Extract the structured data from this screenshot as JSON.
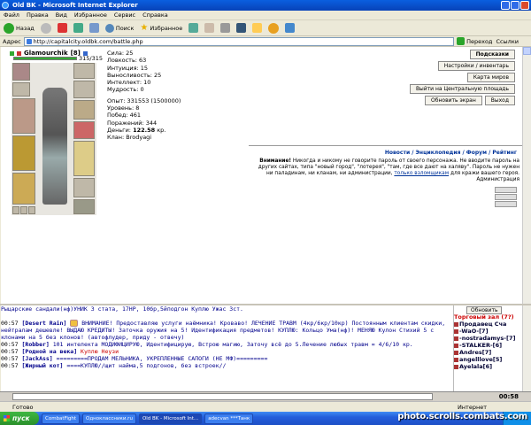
{
  "window": {
    "title": "Old BK - Microsoft Internet Explorer"
  },
  "menu": [
    "Файл",
    "Правка",
    "Вид",
    "Избранное",
    "Сервис",
    "Справка"
  ],
  "toolbar": {
    "back": "Назад",
    "search": "Поиск",
    "favorites": "Избранное"
  },
  "address": {
    "label": "Адрес",
    "url": "http://capitalcity.oldbk.com/battle.php",
    "go": "Переход",
    "links": "Ссылки"
  },
  "character": {
    "name": "Glamourchik",
    "level": "[8]",
    "hp": "315/315",
    "stats": {
      "strength": "Сила: 25",
      "agility": "Ловкость: 63",
      "intuition": "Интуиция: 15",
      "endurance": "Выносливость: 25",
      "intellect": "Интеллект: 10",
      "wisdom": "Мудрость: 0",
      "exp": "Опыт: 331553 (1500000)",
      "level": "Уровень: 8",
      "wins": "Побед: 461",
      "losses": "Поражений: 344",
      "money_label": "Деньги:",
      "money": "122.58",
      "money_unit": "кр.",
      "clan": "Клан: Brodyagi"
    }
  },
  "right_buttons": {
    "podskazki": "Подсказки",
    "settings": "Настройки / инвентарь",
    "map": "Карта миров",
    "exit": "Выйти на Центральную площадь",
    "refresh": "Обновить экран",
    "back": "Выход"
  },
  "links": "Новости / Энциклопедия / Форум / Рейтинг",
  "warning": {
    "bold": "Внимание!",
    "text": "Никогда и никому не говорите пароль от своего персонажа. Не вводите пароль на других сайтах, типа \"новый город\", \"лотерея\", \"там, где все дают на халяву\". Пароль не нужен ни паладинам, ни кланам, ни администрации,",
    "link": "только взломщикам",
    "tail": "для кражи вашего героя.",
    "admin": "Администрация"
  },
  "chat": [
    {
      "time": "",
      "nick": "",
      "text": "Рыцарские сандали(нф)УНИК 3 стата, 17HP, 10бр,5йподгон  Куплю Ужас 3ст."
    },
    {
      "time": "",
      "nick": "",
      "text": ""
    },
    {
      "time": "00:57",
      "nick": "[Desert Rain]",
      "text": "ВНИМАНИЕ! Предоставляю услуги наёмника! Кроваво!     ЛЕЧЕНИЕ ТРАВМ (4кр/6кр/10кр) Постоянным клиентам скидки, нейтралам дешевле!  ВЫДАЮ КРЕДИТЫ! Заточка оружия на 5! Идентификация предметов! КУПЛЮ: Кольцо Ума(нф)! МЕНЯЮ Кулон Стихий 5 с клонами на 5 без клонов!  (автофлудер, приду - отвечу)"
    },
    {
      "time": "00:57",
      "nick": "[Robber]",
      "text": "101 интелекта МОДИФИЦИРУЮ, Идентифицирую, Встрою магию, Заточу всё до 5.Лечение любых травм = 4/6/10 кр."
    },
    {
      "time": "00:57",
      "nick": "[Родной на века]",
      "text": "Куплю Неузи"
    },
    {
      "time": "00:57",
      "nick": "[JackAss]",
      "text": "=========ПРОДАМ МЕЛЬНИКА, УКРЕПЛЕННЫЕ САПОГИ (НЕ МФ)========="
    },
    {
      "time": "00:57",
      "nick": "[Жирный кот]",
      "text": "====КУПЛЮ//щит найма,5 подгонов, без встроек//"
    }
  ],
  "sidebar": {
    "refresh": "Обновить",
    "title": "Торговый зал (7?)",
    "users": [
      "Продавец Сча",
      "-WaO-[7]",
      "-nostradamys-[7]",
      "-STALKER-[6]",
      "Andres[7]",
      "angelllove[5]",
      "Ayelala[6]"
    ]
  },
  "clock": "00:58",
  "status": {
    "left": "Готово",
    "zone": "Интернет"
  },
  "taskbar": {
    "start": "пуск",
    "tasks": [
      "CombatFight",
      "Одноклассники.ru",
      "Old BK - Microsoft Int...",
      "adecvan ***Танк"
    ],
    "time": "0:58"
  },
  "watermark": "photo.scrolls.combats.com"
}
